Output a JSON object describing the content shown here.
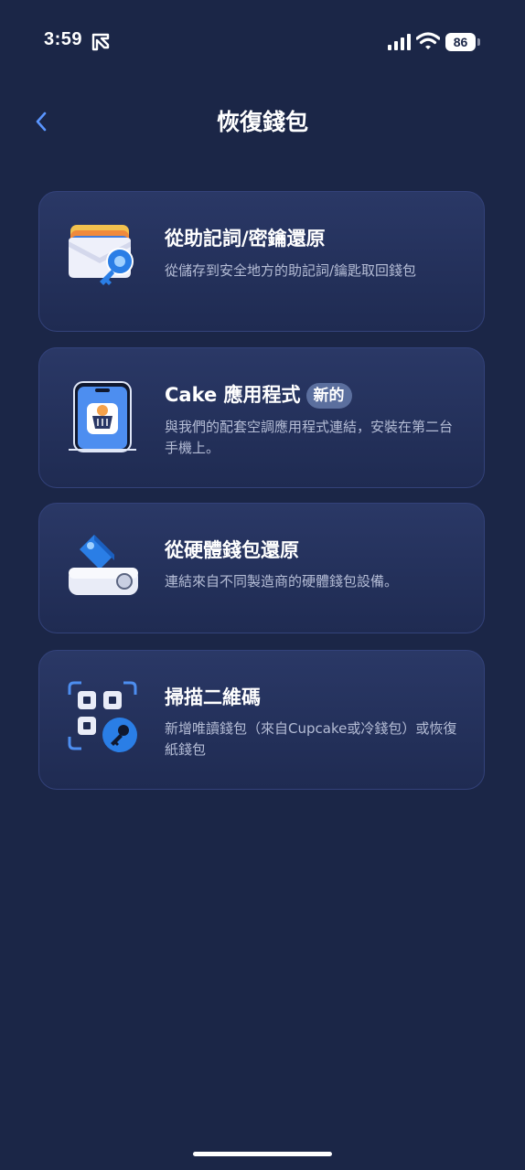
{
  "status_bar": {
    "time": "3:59",
    "battery": "86"
  },
  "header": {
    "title": "恢復錢包"
  },
  "options": [
    {
      "title": "從助記詞/密鑰還原",
      "description": "從儲存到安全地方的助記詞/鑰匙取回錢包",
      "icon": "wallet-key-icon"
    },
    {
      "title": "Cake 應用程式",
      "badge": "新的",
      "description": "與我們的配套空調應用程式連結，安裝在第二台手機上。",
      "icon": "phone-app-icon"
    },
    {
      "title": "從硬體錢包還原",
      "description": "連結來自不同製造商的硬體錢包設備。",
      "icon": "hardware-wallet-icon"
    },
    {
      "title": "掃描二維碼",
      "description": "新增唯讀錢包（來自Cupcake或冷錢包）或恢復紙錢包",
      "icon": "qr-key-icon"
    }
  ],
  "colors": {
    "background": "#1b2647",
    "card": "#2a3866",
    "card_border": "#33427a",
    "accent_blue": "#3b8cf0",
    "badge": "#5b6f9e",
    "description": "#b5bdd6"
  }
}
